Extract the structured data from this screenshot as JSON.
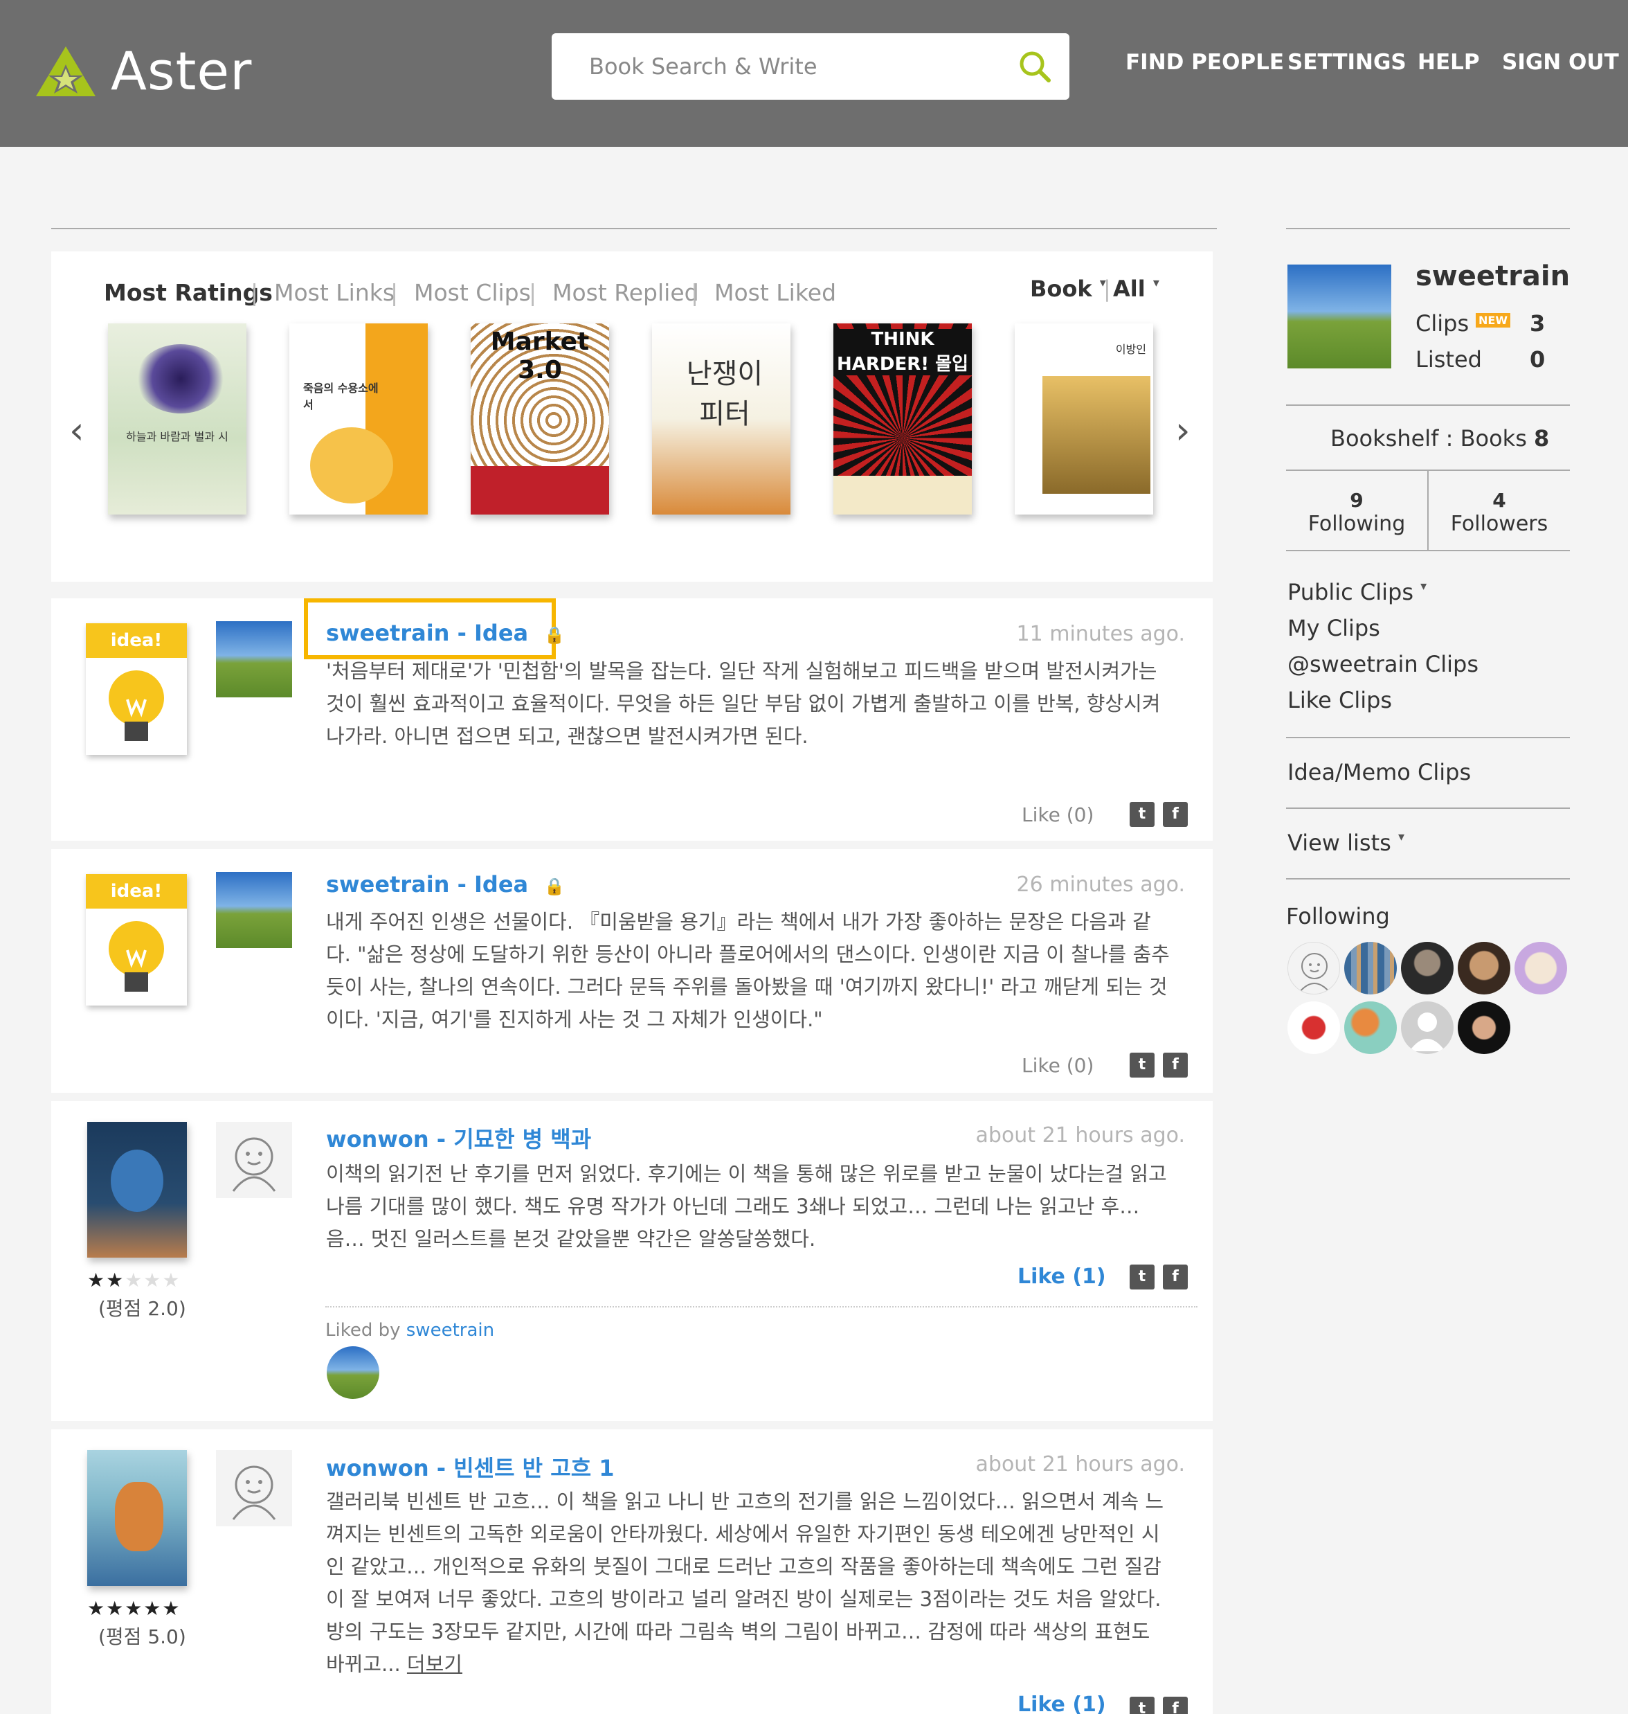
{
  "app": {
    "name": "Aster",
    "brand_color": "#a7c41c",
    "header_bg": "#6e6e6e",
    "link_color": "#2f87d6"
  },
  "search": {
    "placeholder": "Book Search & Write",
    "icon": "search-icon"
  },
  "nav": [
    "FIND PEOPLE",
    "SETTINGS",
    "HELP",
    "SIGN OUT"
  ],
  "tabs": [
    {
      "label": "Most Ratings",
      "active": true
    },
    {
      "label": "Most Links"
    },
    {
      "label": "Most Clips"
    },
    {
      "label": "Most Replied"
    },
    {
      "label": "Most Liked"
    }
  ],
  "filters": {
    "type": "Book",
    "scope": "All"
  },
  "books": [
    {
      "title": "하늘과 바람과 별과 시"
    },
    {
      "title": "죽음의 수용소에서"
    },
    {
      "title": "Market 3.0"
    },
    {
      "title": "난쟁이 피터"
    },
    {
      "title": "THINK HARDER! 몰입"
    },
    {
      "title": "이방인"
    }
  ],
  "clips": [
    {
      "title": "sweetrain - Idea",
      "time": "11 minutes ago.",
      "kind": "idea",
      "icon_label": "idea!",
      "lines": [
        "'처음부터 제대로'가 '민첩함'의 발목을 잡는다. 일단 작게 실험해보고 피드백을 받으며 발전시켜가는",
        "것이 훨씬 효과적이고 효율적이다. 무엇을 하든 일단 부담 없이 가볍게 출발하고 이를 반복, 향상시켜",
        "나가라. 아니면 접으면 되고, 괜찮으면 발전시켜가면 된다."
      ],
      "like": "Like (0)"
    },
    {
      "title": "sweetrain - Idea",
      "time": "26 minutes ago.",
      "kind": "idea",
      "icon_label": "idea!",
      "lines": [
        "내게 주어진 인생은 선물이다. 『미움받을 용기』라는 책에서 내가 가장 좋아하는 문장은 다음과 같",
        "다. \"삶은 정상에 도달하기 위한 등산이 아니라 플로어에서의 댄스이다. 인생이란 지금 이 찰나를 춤추",
        "듯이 사는, 찰나의 연속이다. 그러다 문득 주위를 돌아봤을 때 '여기까지 왔다니!' 라고 깨닫게 되는 것",
        "이다. '지금, 여기'를 진지하게 사는 것 그 자체가 인생이다.\""
      ],
      "like": "Like (0)"
    },
    {
      "title": "wonwon - 기묘한 병 백과",
      "time": "about 21 hours ago.",
      "kind": "book",
      "stars": "★★",
      "stars_empty": "★★★",
      "rating": "(평점 2.0)",
      "lines": [
        "이책의 읽기전 난 후기를 먼저 읽었다. 후기에는 이 책을 통해 많은 위로를 받고 눈물이 났다는걸 읽고",
        "나름 기대를 많이 했다. 책도 유명 작가가 아닌데 그래도 3쇄나 되었고… 그런데 나는 읽고난 후…",
        "음… 멋진 일러스트를 본것 같았을뿐 약간은 알쏭달쏭했다."
      ],
      "like": "Like (1)",
      "liked_by_label": "Liked by",
      "liked_by_user": "sweetrain"
    },
    {
      "title": "wonwon - 빈센트 반 고흐 1",
      "time": "about 21 hours ago.",
      "kind": "book",
      "stars": "★★★★★",
      "stars_empty": "",
      "rating": "(평점 5.0)",
      "lines": [
        "갤러리북 빈센트 반 고흐… 이 책을 읽고 나니 반 고흐의 전기를 읽은 느낌이었다… 읽으면서 계속 느",
        "껴지는 빈센트의 고독한 외로움이 안타까웠다. 세상에서 유일한 자기편인 동생 테오에겐 낭만적인 시",
        "인 같았고… 개인적으로 유화의 붓질이 그대로 드러난 고흐의 작품을 좋아하는데 책속에도 그런 질감",
        "이 잘 보여져 너무 좋았다. 고흐의 방이라고 널리 알려진 방이 실제로는 3점이라는 것도 처음 알았다.",
        "방의 구도는 3장모두 같지만, 시간에 따라 그림속 벽의 그림이 바뀌고… 감정에 따라 색상의 표현도",
        "바뀌고..."
      ],
      "more": "더보기",
      "like": "Like (1)"
    }
  ],
  "social": {
    "twitter": "twitter-icon",
    "facebook": "facebook-icon"
  },
  "profile": {
    "name": "sweetrain",
    "clips_label": "Clips",
    "new_badge": "NEW",
    "clips": "3",
    "listed_label": "Listed",
    "listed": "0",
    "bookshelf_label": "Bookshelf : Books",
    "bookshelf": "8",
    "following_count": "9",
    "following_label": "Following",
    "followers_count": "4",
    "followers_label": "Followers"
  },
  "sidebar": {
    "links1": [
      "Public Clips",
      "My Clips",
      "@sweetrain Clips",
      "Like Clips"
    ],
    "idea_memo": "Idea/Memo Clips",
    "view_lists": "View lists",
    "following_title": "Following"
  }
}
